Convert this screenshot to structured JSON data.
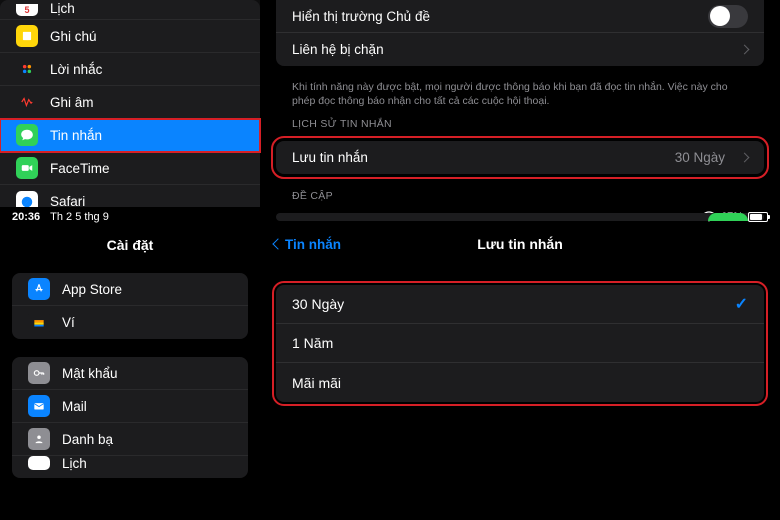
{
  "top": {
    "sidebar": [
      {
        "icon": "cal",
        "label": "Lịch"
      },
      {
        "icon": "note",
        "label": "Ghi chú"
      },
      {
        "icon": "rem",
        "label": "Lời nhắc"
      },
      {
        "icon": "rec",
        "label": "Ghi âm"
      },
      {
        "icon": "msg",
        "label": "Tin nhắn",
        "selected": true,
        "highlight": true
      },
      {
        "icon": "ft",
        "label": "FaceTime"
      },
      {
        "icon": "saf",
        "label": "Safari"
      }
    ],
    "main": {
      "row_subject": "Hiển thị trường Chủ đề",
      "row_blocked": "Liên hệ bị chặn",
      "desc": "Khi tính năng này được bật, mọi người được thông báo khi bạn đã đọc tin nhắn. Việc này cho phép đọc thông báo nhận cho tất cả các cuộc hội thoại.",
      "section_history": "LỊCH SỬ TIN NHẮN",
      "keep_label": "Lưu tin nhắn",
      "keep_value": "30 Ngày",
      "section_mention": "ĐỀ CẬP"
    }
  },
  "bottom": {
    "status": {
      "time": "20:36",
      "date": "Th 2 5 thg 9",
      "battery": "67%"
    },
    "sidebar": {
      "title": "Cài đặt",
      "g1": [
        {
          "icon": "as",
          "label": "App Store"
        },
        {
          "icon": "wl",
          "label": "Ví"
        }
      ],
      "g2": [
        {
          "icon": "pw",
          "label": "Mật khẩu"
        },
        {
          "icon": "ml",
          "label": "Mail"
        },
        {
          "icon": "ct",
          "label": "Danh bạ"
        },
        {
          "icon": "cal2",
          "label": "Lịch"
        }
      ]
    },
    "main": {
      "back": "Tin nhắn",
      "title": "Lưu tin nhắn",
      "options": [
        {
          "label": "30 Ngày",
          "checked": true
        },
        {
          "label": "1 Năm"
        },
        {
          "label": "Mãi mãi"
        }
      ]
    }
  }
}
